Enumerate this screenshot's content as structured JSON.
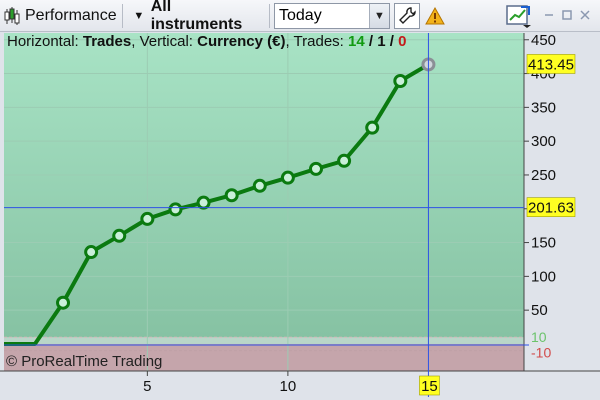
{
  "toolbar": {
    "performance_label": "Performance",
    "instruments_label": "All instruments",
    "period_value": "Today",
    "dropdown_arrow": "▼",
    "icons": [
      "bar-chart-icon",
      "dropdown-arrow-icon",
      "wrench-icon",
      "warning-icon",
      "export-chart-icon",
      "minimize-icon",
      "maximize-icon",
      "close-icon"
    ]
  },
  "header": {
    "horizontal_prefix": "Horizontal: ",
    "horizontal_value": "Trades",
    "vertical_prefix": ", Vertical: ",
    "vertical_value": "Currency (€)",
    "trades_prefix": ", Trades: ",
    "wins": "14",
    "slash1": " / ",
    "neutral": "1",
    "slash2": " / ",
    "losses": "0"
  },
  "footer": {
    "copyright": "© ProRealTime Trading"
  },
  "colors": {
    "line": "#0b7a10",
    "area_top": "#a8e3c5",
    "area_bottom": "#86c2a3",
    "loss_zone": "#c5a5ab",
    "crosshair": "#2e52e6",
    "tag_bg": "#ffff22",
    "wins": "#119a11",
    "losses": "#c41a1a"
  },
  "chart_data": {
    "type": "line",
    "x": [
      1,
      2,
      3,
      4,
      5,
      6,
      7,
      8,
      9,
      10,
      11,
      12,
      13,
      14,
      15
    ],
    "values": [
      0,
      61,
      136,
      160,
      185,
      199,
      209,
      220,
      234,
      246,
      259,
      271,
      320,
      389,
      413.45
    ],
    "xlim": [
      -0.1,
      18.4
    ],
    "ylim": [
      -40,
      460
    ],
    "x_ticks": [
      "5",
      "10"
    ],
    "y_ticks": [
      "450",
      "400",
      "350",
      "300",
      "250",
      "200",
      "150",
      "100",
      "50"
    ],
    "zero_band_labels": [
      "10",
      "-10"
    ],
    "crosshair_x": "15",
    "crosshair_y_label": "201.63",
    "last_value_label": "413.45",
    "crosshair_y_value": 201.63
  }
}
